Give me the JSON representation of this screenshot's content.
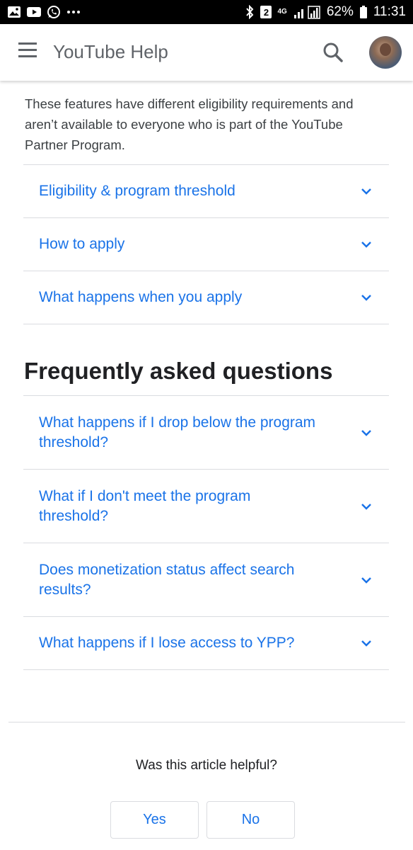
{
  "status_bar": {
    "battery": "62%",
    "time": "11:31",
    "sim_badge": "2",
    "network": "4G"
  },
  "app_bar": {
    "title": "YouTube Help"
  },
  "intro_text": "These features have different eligibility requirements and aren’t available to everyone who is part of the YouTube Partner Program.",
  "sections_top": [
    {
      "label": "Eligibility & program threshold"
    },
    {
      "label": "How to apply"
    },
    {
      "label": "What happens when you apply"
    }
  ],
  "faq": {
    "heading": "Frequently asked questions",
    "items": [
      {
        "label": "What happens if I drop below the program threshold?"
      },
      {
        "label": "What if I don't meet the program threshold?"
      },
      {
        "label": "Does monetization status affect search results?"
      },
      {
        "label": "What happens if I lose access to YPP?"
      }
    ]
  },
  "feedback": {
    "question": "Was this article helpful?",
    "yes_label": "Yes",
    "no_label": "No"
  },
  "colors": {
    "link_blue": "#1a73e8",
    "divider": "#dadce0",
    "icon_gray": "#5f6368"
  }
}
